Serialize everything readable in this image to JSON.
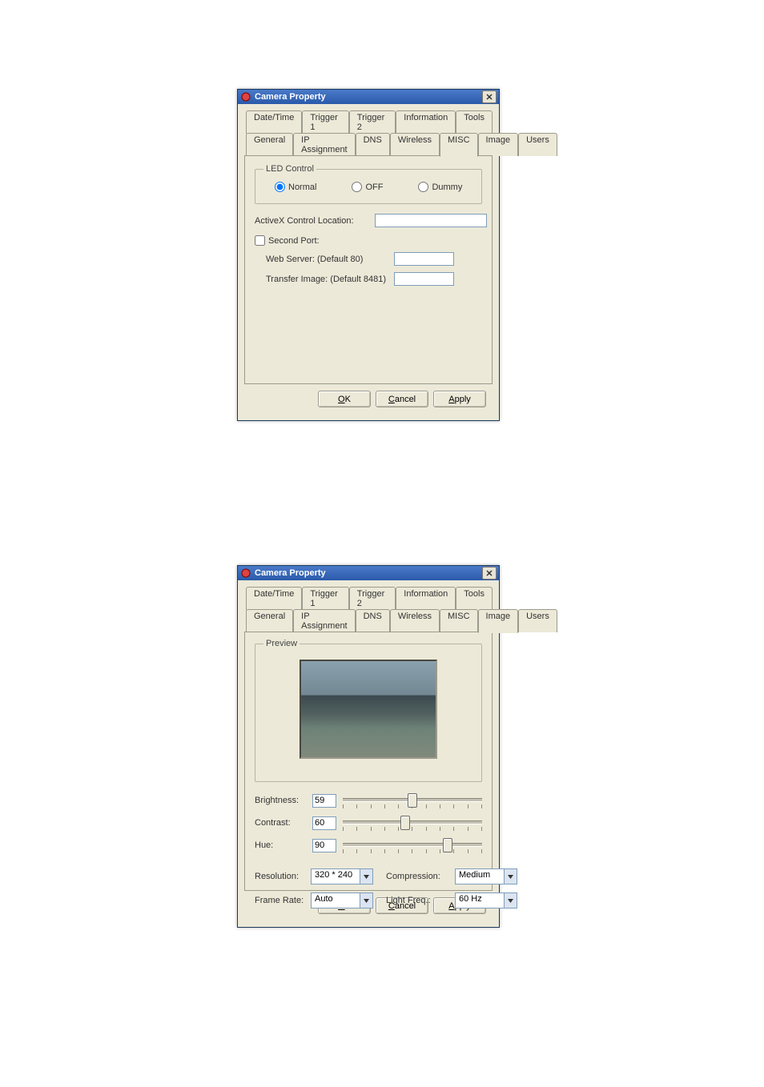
{
  "dialogs": {
    "misc": {
      "title": "Camera Property",
      "tabs_back": [
        "Date/Time",
        "Trigger 1",
        "Trigger 2",
        "Information",
        "Tools"
      ],
      "tabs_front": [
        "General",
        "IP Assignment",
        "DNS",
        "Wireless",
        "MISC",
        "Image",
        "Users"
      ],
      "active_tab": "MISC",
      "led_group": "LED Control",
      "led_opts": {
        "normal": "Normal",
        "off": "OFF",
        "dummy": "Dummy"
      },
      "activex_label": "ActiveX Control Location:",
      "activex_value": "",
      "second_port_label": "Second Port:",
      "webserver_label": "Web Server: (Default 80)",
      "webserver_value": "",
      "transfer_label": "Transfer Image: (Default 8481)",
      "transfer_value": "",
      "buttons": {
        "ok": "OK",
        "cancel": "Cancel",
        "apply": "Apply"
      },
      "mnemonic": {
        "ok": "O",
        "cancel": "C",
        "apply": "A"
      }
    },
    "image": {
      "title": "Camera Property",
      "tabs_back": [
        "Date/Time",
        "Trigger 1",
        "Trigger 2",
        "Information",
        "Tools"
      ],
      "tabs_front": [
        "General",
        "IP Assignment",
        "DNS",
        "Wireless",
        "MISC",
        "Image",
        "Users"
      ],
      "active_tab": "Image",
      "preview_label": "Preview",
      "sliders": {
        "brightness": {
          "label": "Brightness:",
          "value": "59",
          "pos": 50
        },
        "contrast": {
          "label": "Contrast:",
          "value": "60",
          "pos": 45
        },
        "hue": {
          "label": "Hue:",
          "value": "90",
          "pos": 75
        }
      },
      "combos": {
        "resolution": {
          "label": "Resolution:",
          "value": "320 * 240"
        },
        "compression": {
          "label": "Compression:",
          "value": "Medium"
        },
        "framerate": {
          "label": "Frame Rate:",
          "value": "Auto"
        },
        "lightfreq": {
          "label": "Light Freq.:",
          "value": "60 Hz"
        }
      },
      "buttons": {
        "ok": "OK",
        "cancel": "Cancel",
        "apply": "Apply"
      },
      "mnemonic": {
        "ok": "O",
        "cancel": "C",
        "apply": "A"
      }
    }
  }
}
